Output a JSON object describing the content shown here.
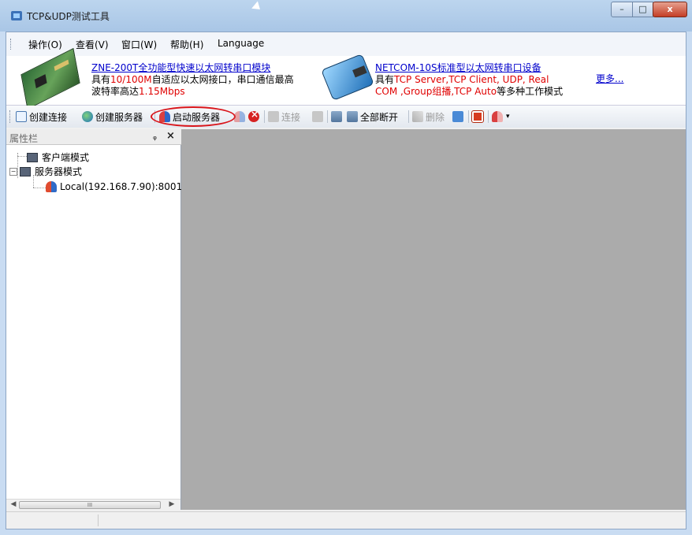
{
  "window": {
    "title": "TCP&UDP测试工具",
    "minimize": "–",
    "maximize": "□",
    "close": "x"
  },
  "menu": {
    "items": [
      {
        "label": "操作(O)"
      },
      {
        "label": "查看(V)"
      },
      {
        "label": "窗口(W)"
      },
      {
        "label": "帮助(H)"
      },
      {
        "label": "Language"
      }
    ]
  },
  "banner": {
    "ad1": {
      "title": "ZNE-200T全功能型快速以太网转串口模块",
      "line1_prefix": "具有",
      "line1_red": "10/100M",
      "line1_suffix": "自适应以太网接口，串口通信最高",
      "line2_prefix": "波特率高达",
      "line2_red": "1.15Mbps"
    },
    "ad2": {
      "title": "NETCOM-10S标准型以太网转串口设备",
      "line1_prefix": "具有",
      "line1_red": "TCP Server,TCP Client, UDP, Real",
      "line2_red": "COM ,Group组播,TCP Auto",
      "line2_suffix": "等多种工作模式"
    },
    "more": "更多..."
  },
  "toolbar": {
    "create_connection": "创建连接",
    "create_server": "创建服务器",
    "start_server": "启动服务器",
    "connect": "连接",
    "disconnect_all": "全部断开",
    "delete": "删除"
  },
  "properties_pane": {
    "title": "属性栏",
    "pin": "ᵩ",
    "close": "×",
    "tree": {
      "client_mode": "客户端模式",
      "server_mode": "服务器模式",
      "server_entry": "Local(192.168.7.90):8001"
    },
    "scroll_thumb": "III"
  },
  "status": {
    "text": ""
  }
}
